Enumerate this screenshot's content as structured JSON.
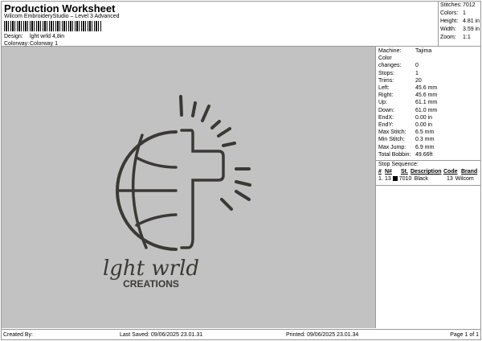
{
  "header": {
    "title": "Production Worksheet",
    "subtitle": "Wilcom EmbroideryStudio – Level 3 Advanced",
    "design_label": "Design:",
    "design_value": "lght wrld 4,8in",
    "colorway_label": "Colorway:",
    "colorway_value": "Colorway 1"
  },
  "stats": [
    {
      "label": "Stitches:",
      "value": "7012"
    },
    {
      "label": "Colors:",
      "value": "1"
    },
    {
      "label": "Height:",
      "value": "4.81 in"
    },
    {
      "label": "Width:",
      "value": "3.59 in"
    },
    {
      "label": "Zoom:",
      "value": "1:1"
    }
  ],
  "design_text": {
    "line1": "lght wrld",
    "line2": "CREATIONS"
  },
  "info": [
    {
      "label": "Machine:",
      "value": "Tajima"
    },
    {
      "label": "Color changes:",
      "value": "0"
    },
    {
      "label": "Stops:",
      "value": "1"
    },
    {
      "label": "Trims:",
      "value": "20"
    },
    {
      "label": "Left:",
      "value": "45.6 mm"
    },
    {
      "label": "Right:",
      "value": "45.6 mm"
    },
    {
      "label": "Up:",
      "value": "61.1 mm"
    },
    {
      "label": "Down:",
      "value": "61.0 mm"
    },
    {
      "label": "EndX:",
      "value": "0.00 in"
    },
    {
      "label": "EndY:",
      "value": "0.00 in"
    },
    {
      "label": "Max Stitch:",
      "value": "6.5 mm"
    },
    {
      "label": "Min Stitch:",
      "value": "0.3 mm"
    },
    {
      "label": "Max Jump:",
      "value": "6.9 mm"
    },
    {
      "label": "Total Bobbin:",
      "value": "49.66ft"
    }
  ],
  "stop_sequence": {
    "title": "Stop Sequence:",
    "headers": [
      "#",
      "N#",
      "St.",
      "Description",
      "Code",
      "Brand"
    ],
    "rows": [
      {
        "num": "1.",
        "n": "13",
        "swatch": "#000000",
        "st": "7010",
        "description": "Black",
        "code": "13",
        "brand": "Wilcom"
      }
    ]
  },
  "footer": {
    "created_by": "Created By:",
    "last_saved": "Last Saved: 09/06/2025 23.01.31",
    "printed": "Printed: 09/06/2025 23.01.34",
    "page": "Page 1 of 1"
  },
  "colors": {
    "canvas": "#c2c2c2",
    "thread": "#3a3935"
  }
}
